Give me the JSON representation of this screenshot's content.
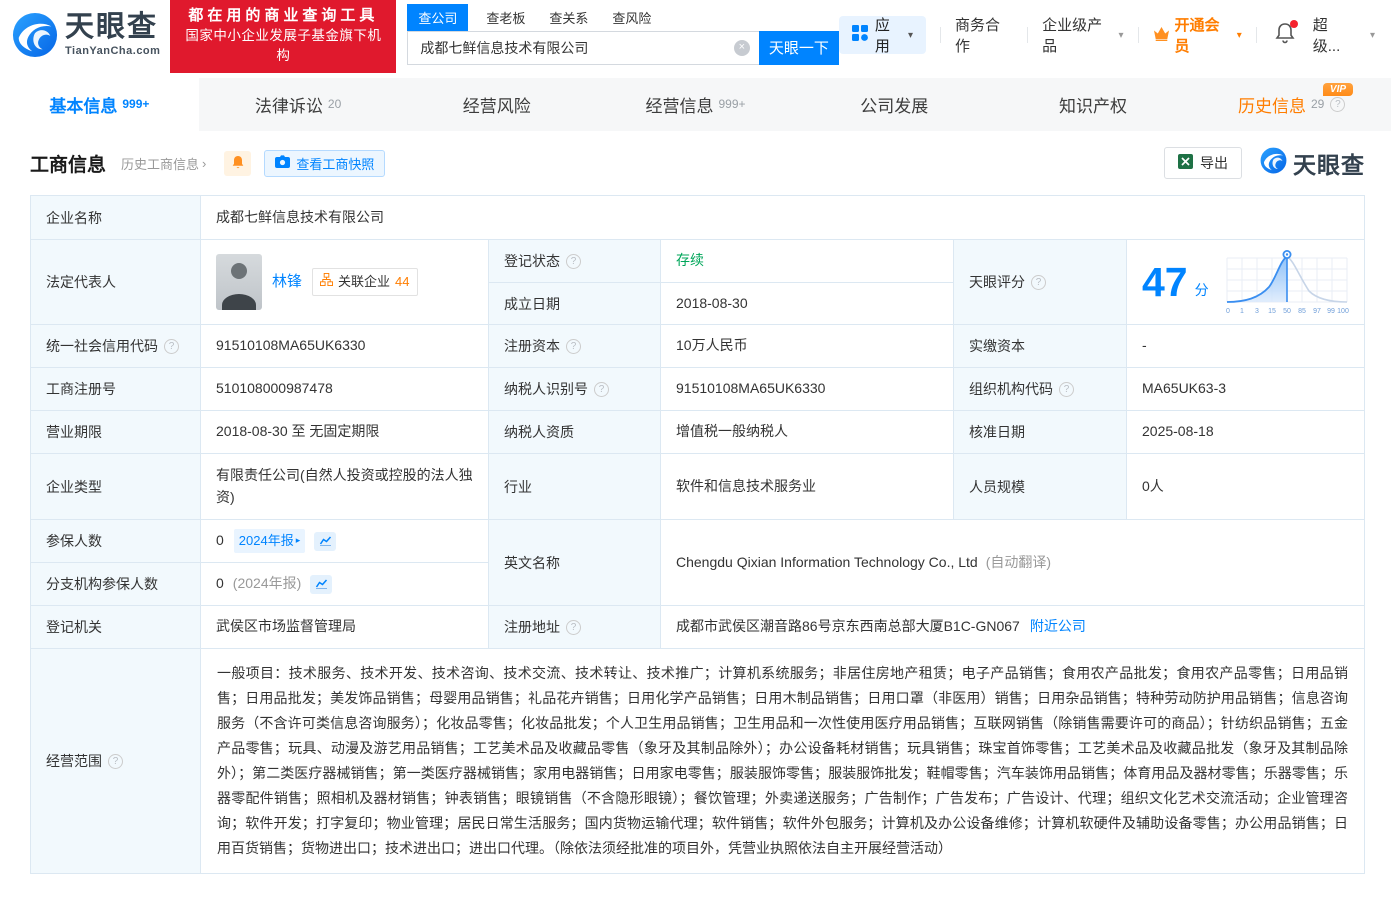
{
  "colors": {
    "primary": "#0084ff",
    "orange": "#ff7d00",
    "green": "#00a65a",
    "banner_red": "#e0192d"
  },
  "icons": {
    "question": "?",
    "caret_down": "▾",
    "caret_right": "▸",
    "chevron_right": "›",
    "close": "×"
  },
  "badges": {
    "vip": "VIP"
  },
  "header": {
    "brand": "天眼查",
    "brand_domain": "TianYanCha.com",
    "banner_line1": "都在用的商业查询工具",
    "banner_line2": "国家中小企业发展子基金旗下机构",
    "search_tabs": [
      {
        "label": "查公司"
      },
      {
        "label": "查老板"
      },
      {
        "label": "查关系"
      },
      {
        "label": "查风险"
      }
    ],
    "search_value": "成都七鲜信息技术有限公司",
    "search_button": "天眼一下",
    "apps_label": "应用",
    "coop_label": "商务合作",
    "enterprise_label": "企业级产品",
    "vip_label": "开通会员",
    "user_label": "超级..."
  },
  "tabs": [
    {
      "label": "基本信息",
      "count": "999+"
    },
    {
      "label": "法律诉讼",
      "count": "20"
    },
    {
      "label": "经营风险",
      "count": ""
    },
    {
      "label": "经营信息",
      "count": "999+"
    },
    {
      "label": "公司发展",
      "count": ""
    },
    {
      "label": "知识产权",
      "count": ""
    },
    {
      "label": "历史信息",
      "count": "29"
    }
  ],
  "section": {
    "title": "工商信息",
    "history_link": "历史工商信息",
    "snapshot_button": "查看工商快照",
    "export_button": "导出",
    "brand": "天眼查"
  },
  "info": {
    "name_label": "企业名称",
    "name": "成都七鲜信息技术有限公司",
    "legal_rep_label": "法定代表人",
    "legal_rep": "林锋",
    "related_label": "关联企业",
    "related_count": "44",
    "status_label": "登记状态",
    "status": "存续",
    "establish_label": "成立日期",
    "establish_date": "2018-08-30",
    "score_label": "天眼评分",
    "score": "47",
    "score_unit": "分",
    "credit_code_label": "统一社会信用代码",
    "credit_code": "91510108MA65UK6330",
    "reg_capital_label": "注册资本",
    "reg_capital": "10万人民币",
    "paid_capital_label": "实缴资本",
    "paid_capital": "-",
    "reg_number_label": "工商注册号",
    "reg_number": "510108000987478",
    "taxpayer_id_label": "纳税人识别号",
    "taxpayer_id": "91510108MA65UK6330",
    "org_code_label": "组织机构代码",
    "org_code": "MA65UK63-3",
    "term_label": "营业期限",
    "term": "2018-08-30 至 无固定期限",
    "taxpayer_quality_label": "纳税人资质",
    "taxpayer_quality": "增值税一般纳税人",
    "approval_label": "核准日期",
    "approval_date": "2025-08-18",
    "type_label": "企业类型",
    "type": "有限责任公司(自然人投资或控股的法人独资)",
    "industry_label": "行业",
    "industry": "软件和信息技术服务业",
    "staff_label": "人员规模",
    "staff": "0人",
    "insured_label": "参保人数",
    "insured_value": "0",
    "insured_report": "2024年报",
    "branch_insured_label": "分支机构参保人数",
    "branch_insured_value": "0",
    "branch_insured_report": "(2024年报)",
    "english_label": "英文名称",
    "english_name": "Chengdu Qixian Information Technology Co., Ltd",
    "english_note": "(自动翻译)",
    "authority_label": "登记机关",
    "authority": "武侯区市场监督管理局",
    "address_label": "注册地址",
    "address": "成都市武侯区潮音路86号京东西南总部大厦B1C-GN067",
    "nearby_link": "附近公司",
    "scope_label": "经营范围",
    "scope": "一般项目：技术服务、技术开发、技术咨询、技术交流、技术转让、技术推广；计算机系统服务；非居住房地产租赁；电子产品销售；食用农产品批发；食用农产品零售；日用品销售；日用品批发；美发饰品销售；母婴用品销售；礼品花卉销售；日用化学产品销售；日用木制品销售；日用口罩（非医用）销售；日用杂品销售；特种劳动防护用品销售；信息咨询服务（不含许可类信息咨询服务）；化妆品零售；化妆品批发；个人卫生用品销售；卫生用品和一次性使用医疗用品销售；互联网销售（除销售需要许可的商品）；针纺织品销售；五金产品零售；玩具、动漫及游艺用品销售；工艺美术品及收藏品零售（象牙及其制品除外）；办公设备耗材销售；玩具销售；珠宝首饰零售；工艺美术品及收藏品批发（象牙及其制品除外）；第二类医疗器械销售；第一类医疗器械销售；家用电器销售；日用家电零售；服装服饰零售；服装服饰批发；鞋帽零售；汽车装饰用品销售；体育用品及器材零售；乐器零售；乐器零配件销售；照相机及器材销售；钟表销售；眼镜销售（不含隐形眼镜）；餐饮管理；外卖递送服务；广告制作；广告发布；广告设计、代理；组织文化艺术交流活动；企业管理咨询；软件开发；打字复印；物业管理；居民日常生活服务；国内货物运输代理；软件销售；软件外包服务；计算机及办公设备维修；计算机软硬件及辅助设备零售；办公用品销售；日用百货销售；货物进出口；技术进出口；进出口代理。（除依法须经批准的项目外，凭营业执照依法自主开展经营活动）"
  },
  "score_chart": {
    "type": "area",
    "axis": [
      "0",
      "1",
      "3",
      "15",
      "50",
      "85",
      "97",
      "99",
      "100"
    ],
    "marker_at": "50",
    "score": 47
  }
}
